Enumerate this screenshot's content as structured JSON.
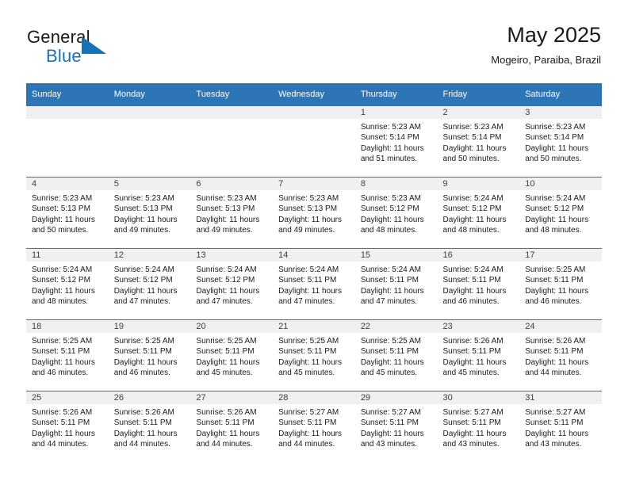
{
  "brand": {
    "word1": "General",
    "word2": "Blue",
    "accent_color": "#1673b8",
    "mark": "triangle-icon"
  },
  "header": {
    "title": "May 2025",
    "subtitle": "Mogeiro, Paraiba, Brazil"
  },
  "calendar": {
    "header_bg": "#2e75b6",
    "daynum_bg": "#f0f0f0",
    "weekdays": [
      "Sunday",
      "Monday",
      "Tuesday",
      "Wednesday",
      "Thursday",
      "Friday",
      "Saturday"
    ],
    "weeks": [
      [
        {
          "day": "",
          "lines": []
        },
        {
          "day": "",
          "lines": []
        },
        {
          "day": "",
          "lines": []
        },
        {
          "day": "",
          "lines": []
        },
        {
          "day": "1",
          "lines": [
            "Sunrise: 5:23 AM",
            "Sunset: 5:14 PM",
            "Daylight: 11 hours",
            "and 51 minutes."
          ]
        },
        {
          "day": "2",
          "lines": [
            "Sunrise: 5:23 AM",
            "Sunset: 5:14 PM",
            "Daylight: 11 hours",
            "and 50 minutes."
          ]
        },
        {
          "day": "3",
          "lines": [
            "Sunrise: 5:23 AM",
            "Sunset: 5:14 PM",
            "Daylight: 11 hours",
            "and 50 minutes."
          ]
        }
      ],
      [
        {
          "day": "4",
          "lines": [
            "Sunrise: 5:23 AM",
            "Sunset: 5:13 PM",
            "Daylight: 11 hours",
            "and 50 minutes."
          ]
        },
        {
          "day": "5",
          "lines": [
            "Sunrise: 5:23 AM",
            "Sunset: 5:13 PM",
            "Daylight: 11 hours",
            "and 49 minutes."
          ]
        },
        {
          "day": "6",
          "lines": [
            "Sunrise: 5:23 AM",
            "Sunset: 5:13 PM",
            "Daylight: 11 hours",
            "and 49 minutes."
          ]
        },
        {
          "day": "7",
          "lines": [
            "Sunrise: 5:23 AM",
            "Sunset: 5:13 PM",
            "Daylight: 11 hours",
            "and 49 minutes."
          ]
        },
        {
          "day": "8",
          "lines": [
            "Sunrise: 5:23 AM",
            "Sunset: 5:12 PM",
            "Daylight: 11 hours",
            "and 48 minutes."
          ]
        },
        {
          "day": "9",
          "lines": [
            "Sunrise: 5:24 AM",
            "Sunset: 5:12 PM",
            "Daylight: 11 hours",
            "and 48 minutes."
          ]
        },
        {
          "day": "10",
          "lines": [
            "Sunrise: 5:24 AM",
            "Sunset: 5:12 PM",
            "Daylight: 11 hours",
            "and 48 minutes."
          ]
        }
      ],
      [
        {
          "day": "11",
          "lines": [
            "Sunrise: 5:24 AM",
            "Sunset: 5:12 PM",
            "Daylight: 11 hours",
            "and 48 minutes."
          ]
        },
        {
          "day": "12",
          "lines": [
            "Sunrise: 5:24 AM",
            "Sunset: 5:12 PM",
            "Daylight: 11 hours",
            "and 47 minutes."
          ]
        },
        {
          "day": "13",
          "lines": [
            "Sunrise: 5:24 AM",
            "Sunset: 5:12 PM",
            "Daylight: 11 hours",
            "and 47 minutes."
          ]
        },
        {
          "day": "14",
          "lines": [
            "Sunrise: 5:24 AM",
            "Sunset: 5:11 PM",
            "Daylight: 11 hours",
            "and 47 minutes."
          ]
        },
        {
          "day": "15",
          "lines": [
            "Sunrise: 5:24 AM",
            "Sunset: 5:11 PM",
            "Daylight: 11 hours",
            "and 47 minutes."
          ]
        },
        {
          "day": "16",
          "lines": [
            "Sunrise: 5:24 AM",
            "Sunset: 5:11 PM",
            "Daylight: 11 hours",
            "and 46 minutes."
          ]
        },
        {
          "day": "17",
          "lines": [
            "Sunrise: 5:25 AM",
            "Sunset: 5:11 PM",
            "Daylight: 11 hours",
            "and 46 minutes."
          ]
        }
      ],
      [
        {
          "day": "18",
          "lines": [
            "Sunrise: 5:25 AM",
            "Sunset: 5:11 PM",
            "Daylight: 11 hours",
            "and 46 minutes."
          ]
        },
        {
          "day": "19",
          "lines": [
            "Sunrise: 5:25 AM",
            "Sunset: 5:11 PM",
            "Daylight: 11 hours",
            "and 46 minutes."
          ]
        },
        {
          "day": "20",
          "lines": [
            "Sunrise: 5:25 AM",
            "Sunset: 5:11 PM",
            "Daylight: 11 hours",
            "and 45 minutes."
          ]
        },
        {
          "day": "21",
          "lines": [
            "Sunrise: 5:25 AM",
            "Sunset: 5:11 PM",
            "Daylight: 11 hours",
            "and 45 minutes."
          ]
        },
        {
          "day": "22",
          "lines": [
            "Sunrise: 5:25 AM",
            "Sunset: 5:11 PM",
            "Daylight: 11 hours",
            "and 45 minutes."
          ]
        },
        {
          "day": "23",
          "lines": [
            "Sunrise: 5:26 AM",
            "Sunset: 5:11 PM",
            "Daylight: 11 hours",
            "and 45 minutes."
          ]
        },
        {
          "day": "24",
          "lines": [
            "Sunrise: 5:26 AM",
            "Sunset: 5:11 PM",
            "Daylight: 11 hours",
            "and 44 minutes."
          ]
        }
      ],
      [
        {
          "day": "25",
          "lines": [
            "Sunrise: 5:26 AM",
            "Sunset: 5:11 PM",
            "Daylight: 11 hours",
            "and 44 minutes."
          ]
        },
        {
          "day": "26",
          "lines": [
            "Sunrise: 5:26 AM",
            "Sunset: 5:11 PM",
            "Daylight: 11 hours",
            "and 44 minutes."
          ]
        },
        {
          "day": "27",
          "lines": [
            "Sunrise: 5:26 AM",
            "Sunset: 5:11 PM",
            "Daylight: 11 hours",
            "and 44 minutes."
          ]
        },
        {
          "day": "28",
          "lines": [
            "Sunrise: 5:27 AM",
            "Sunset: 5:11 PM",
            "Daylight: 11 hours",
            "and 44 minutes."
          ]
        },
        {
          "day": "29",
          "lines": [
            "Sunrise: 5:27 AM",
            "Sunset: 5:11 PM",
            "Daylight: 11 hours",
            "and 43 minutes."
          ]
        },
        {
          "day": "30",
          "lines": [
            "Sunrise: 5:27 AM",
            "Sunset: 5:11 PM",
            "Daylight: 11 hours",
            "and 43 minutes."
          ]
        },
        {
          "day": "31",
          "lines": [
            "Sunrise: 5:27 AM",
            "Sunset: 5:11 PM",
            "Daylight: 11 hours",
            "and 43 minutes."
          ]
        }
      ]
    ]
  }
}
